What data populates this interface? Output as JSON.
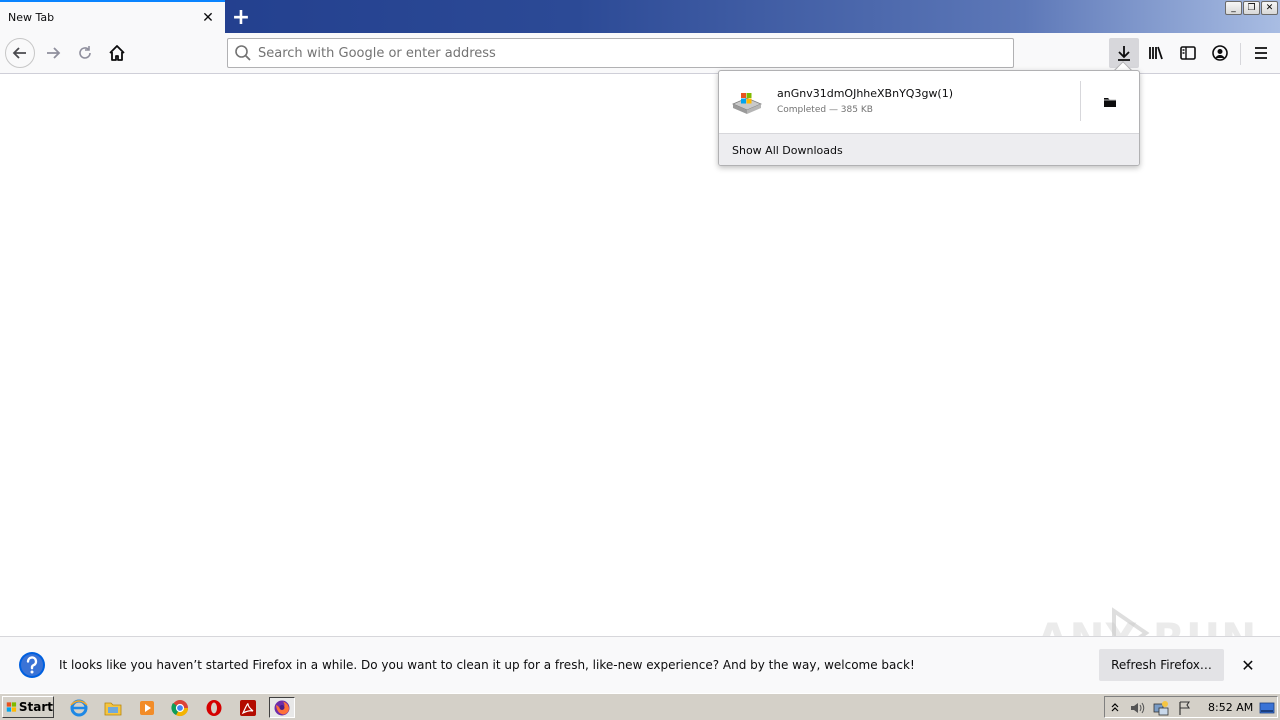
{
  "browser": {
    "tab": {
      "title": "New Tab",
      "close_glyph": "✕"
    },
    "new_tab_glyph": "+",
    "window_controls": {
      "minimize": "_",
      "restore": "❐",
      "close": "✕"
    },
    "urlbar": {
      "placeholder": "Search with Google or enter address",
      "value": ""
    },
    "toolbar_icons": [
      "back-icon",
      "forward-icon",
      "reload-icon",
      "home-icon",
      "download-icon",
      "library-icon",
      "sidebar-icon",
      "account-icon",
      "menu-icon"
    ]
  },
  "downloads_panel": {
    "item": {
      "filename": "anGnv31dmOJhheXBnYQ3gw(1)",
      "status": "Completed — 385 KB"
    },
    "footer_label": "Show All Downloads"
  },
  "notification": {
    "message": "It looks like you haven’t started Firefox in a while. Do you want to clean it up for a fresh, like-new experience? And by the way, welcome back!",
    "button_label": "Refresh Firefox…",
    "close_glyph": "✕"
  },
  "watermark": {
    "text": "ANY RUN"
  },
  "taskbar": {
    "start_label": "Start",
    "apps": [
      "ie-icon",
      "explorer-icon",
      "media-player-icon",
      "chrome-icon",
      "opera-icon",
      "acrobat-icon",
      "firefox-icon"
    ],
    "clock": "8:52 AM"
  },
  "colors": {
    "accent": "#0a84ff",
    "titlebar": "#1e3a8a",
    "taskbar": "#d4d0c8"
  }
}
